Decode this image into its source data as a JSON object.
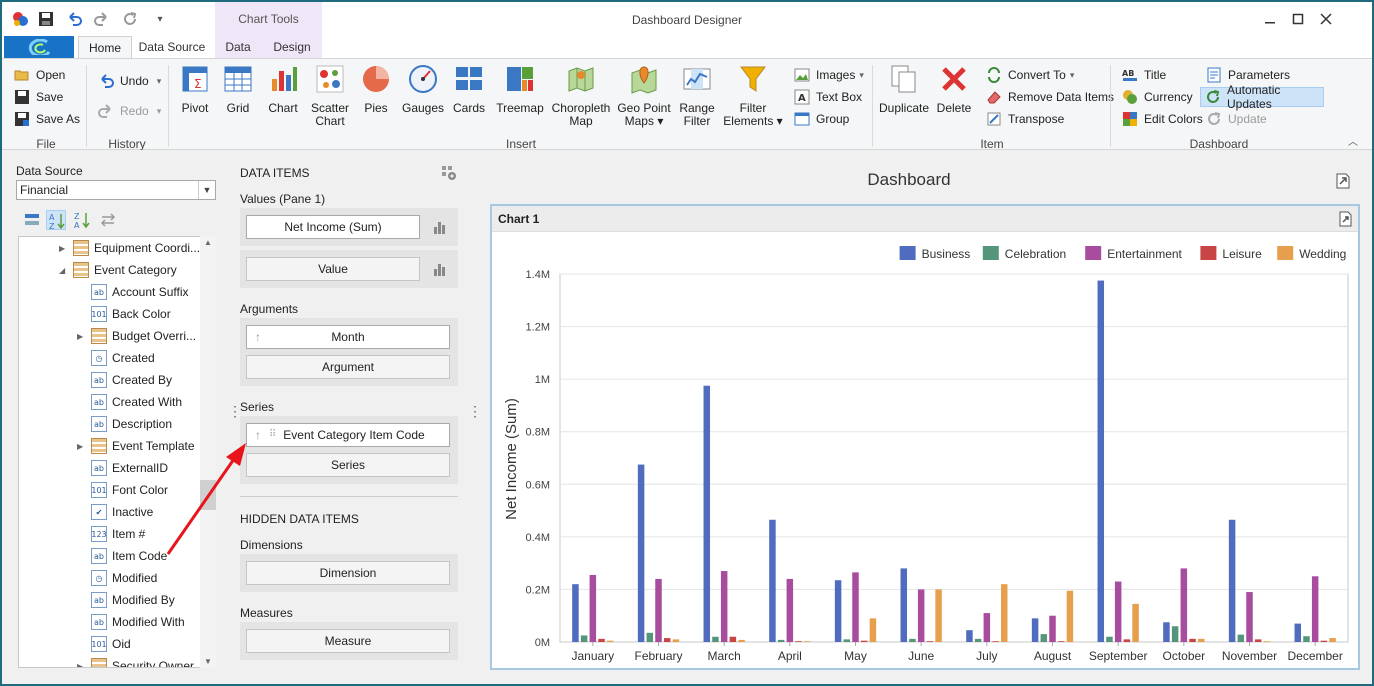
{
  "window": {
    "title": "Dashboard Designer",
    "context_tab_group": "Chart Tools"
  },
  "tabs": [
    "Home",
    "Data Source",
    "Data",
    "Design"
  ],
  "ribbon": {
    "file": {
      "label": "File",
      "items": [
        "Open",
        "Save",
        "Save As"
      ]
    },
    "history": {
      "label": "History",
      "undo": "Undo",
      "redo": "Redo"
    },
    "insert": {
      "label": "Insert",
      "buttons": [
        {
          "l1": "Pivot",
          "l2": ""
        },
        {
          "l1": "Grid",
          "l2": ""
        },
        {
          "l1": "Chart",
          "l2": ""
        },
        {
          "l1": "Scatter",
          "l2": "Chart"
        },
        {
          "l1": "Pies",
          "l2": ""
        },
        {
          "l1": "Gauges",
          "l2": ""
        },
        {
          "l1": "Cards",
          "l2": ""
        },
        {
          "l1": "Treemap",
          "l2": ""
        },
        {
          "l1": "Choropleth",
          "l2": "Map"
        },
        {
          "l1": "Geo Point",
          "l2": "Maps ▾"
        },
        {
          "l1": "Range",
          "l2": "Filter"
        },
        {
          "l1": "Filter",
          "l2": "Elements ▾"
        }
      ],
      "small": [
        "Images",
        "Text Box",
        "Group"
      ]
    },
    "item": {
      "label": "Item",
      "duplicate": "Duplicate",
      "delete": "Delete",
      "small": [
        "Convert To",
        "Remove Data Items",
        "Transpose"
      ]
    },
    "dashboard": {
      "label": "Dashboard",
      "col1": [
        "Title",
        "Currency",
        "Edit Colors"
      ],
      "col2": [
        "Parameters",
        "Automatic Updates",
        "Update"
      ]
    }
  },
  "datasource": {
    "label": "Data Source",
    "value": "Financial"
  },
  "tree": [
    {
      "label": "Equipment Coordi...",
      "icon": "table",
      "level": 1,
      "expander": "▶"
    },
    {
      "label": "Event Category",
      "icon": "table",
      "level": 1,
      "expander": "◢"
    },
    {
      "label": "Account Suffix",
      "icon": "ab",
      "level": 2,
      "expander": ""
    },
    {
      "label": "Back Color",
      "icon": "101",
      "level": 2,
      "expander": ""
    },
    {
      "label": "Budget Overri...",
      "icon": "table",
      "level": 2,
      "expander": "▶"
    },
    {
      "label": "Created",
      "icon": "date",
      "level": 2,
      "expander": ""
    },
    {
      "label": "Created By",
      "icon": "ab",
      "level": 2,
      "expander": ""
    },
    {
      "label": "Created With",
      "icon": "ab",
      "level": 2,
      "expander": ""
    },
    {
      "label": "Description",
      "icon": "ab",
      "level": 2,
      "expander": ""
    },
    {
      "label": "Event Template",
      "icon": "table",
      "level": 2,
      "expander": "▶"
    },
    {
      "label": "ExternalID",
      "icon": "ab",
      "level": 2,
      "expander": ""
    },
    {
      "label": "Font Color",
      "icon": "101",
      "level": 2,
      "expander": ""
    },
    {
      "label": "Inactive",
      "icon": "check",
      "level": 2,
      "expander": ""
    },
    {
      "label": "Item #",
      "icon": "123",
      "level": 2,
      "expander": ""
    },
    {
      "label": "Item Code",
      "icon": "ab",
      "level": 2,
      "expander": ""
    },
    {
      "label": "Modified",
      "icon": "date",
      "level": 2,
      "expander": ""
    },
    {
      "label": "Modified By",
      "icon": "ab",
      "level": 2,
      "expander": ""
    },
    {
      "label": "Modified With",
      "icon": "ab",
      "level": 2,
      "expander": ""
    },
    {
      "label": "Oid",
      "icon": "101",
      "level": 2,
      "expander": ""
    },
    {
      "label": "Security Owner",
      "icon": "table",
      "level": 2,
      "expander": "▶"
    }
  ],
  "data_items": {
    "header": "DATA ITEMS",
    "values_label": "Values (Pane 1)",
    "value_field": "Net Income (Sum)",
    "value_placeholder": "Value",
    "arguments_label": "Arguments",
    "argument_field": "Month",
    "argument_placeholder": "Argument",
    "series_label": "Series",
    "series_field": "Event Category Item Code",
    "series_placeholder": "Series",
    "hidden_header": "HIDDEN DATA ITEMS",
    "dimensions_label": "Dimensions",
    "dimension_placeholder": "Dimension",
    "measures_label": "Measures",
    "measure_placeholder": "Measure"
  },
  "dashboard": {
    "title": "Dashboard",
    "item_title": "Chart 1"
  },
  "colors": {
    "accent": "#1873c6",
    "arrow": "#e8141a"
  },
  "chart_data": {
    "type": "bar",
    "ylabel": "Net Income (Sum)",
    "ylim": [
      0,
      1400000
    ],
    "yticks": [
      {
        "v": 0,
        "label": "0M"
      },
      {
        "v": 200000,
        "label": "0.2M"
      },
      {
        "v": 400000,
        "label": "0.4M"
      },
      {
        "v": 600000,
        "label": "0.6M"
      },
      {
        "v": 800000,
        "label": "0.8M"
      },
      {
        "v": 1000000,
        "label": "1M"
      },
      {
        "v": 1200000,
        "label": "1.2M"
      },
      {
        "v": 1400000,
        "label": "1.4M"
      }
    ],
    "grid": true,
    "legend_position": "top-right",
    "categories": [
      "January",
      "February",
      "March",
      "April",
      "May",
      "June",
      "July",
      "August",
      "September",
      "October",
      "November",
      "December"
    ],
    "series": [
      {
        "name": "Business",
        "color": "#4f6cbf",
        "values": [
          220000,
          675000,
          975000,
          465000,
          235000,
          280000,
          45000,
          90000,
          1375000,
          75000,
          465000,
          70000
        ]
      },
      {
        "name": "Celebration",
        "color": "#55967a",
        "values": [
          25000,
          35000,
          20000,
          8000,
          10000,
          12000,
          12000,
          30000,
          20000,
          60000,
          28000,
          22000
        ]
      },
      {
        "name": "Entertainment",
        "color": "#a84c9e",
        "values": [
          255000,
          240000,
          270000,
          240000,
          265000,
          200000,
          110000,
          100000,
          230000,
          280000,
          190000,
          250000
        ]
      },
      {
        "name": "Leisure",
        "color": "#c94545",
        "values": [
          12000,
          15000,
          20000,
          3000,
          5000,
          3000,
          3000,
          3000,
          10000,
          12000,
          10000,
          5000
        ]
      },
      {
        "name": "Wedding",
        "color": "#e6a04d",
        "values": [
          5000,
          10000,
          8000,
          3000,
          90000,
          200000,
          220000,
          195000,
          145000,
          12000,
          3000,
          15000
        ]
      }
    ]
  }
}
